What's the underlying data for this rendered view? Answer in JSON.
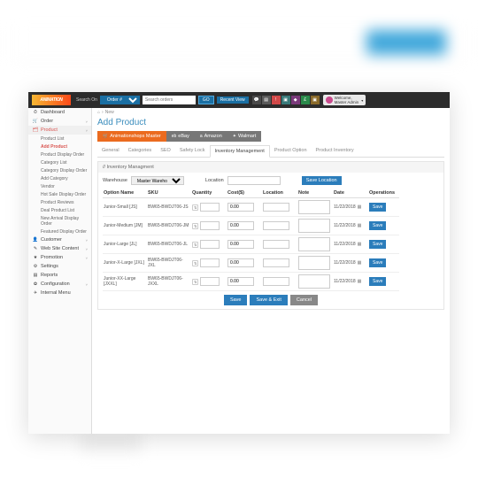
{
  "topbar": {
    "logo": "ANIMATION",
    "search_label": "Search On",
    "search_select": "Order #",
    "search_placeholder": "Search orders",
    "go": "GO",
    "recent": "Recent View",
    "user_name": "Welcome,",
    "user_role": "Master Admin"
  },
  "sidebar": {
    "items": [
      {
        "icon": "⏱",
        "label": "Dashboard",
        "chev": ""
      },
      {
        "icon": "🛒",
        "label": "Order",
        "chev": "˅"
      },
      {
        "icon": "🗂",
        "label": "Product",
        "chev": "˅",
        "active": true
      },
      {
        "icon": "👤",
        "label": "Customer",
        "chev": "˅"
      },
      {
        "icon": "✎",
        "label": "Web Site Content",
        "chev": "˅"
      },
      {
        "icon": "★",
        "label": "Promotion",
        "chev": "˅"
      },
      {
        "icon": "⚙",
        "label": "Settings",
        "chev": ""
      },
      {
        "icon": "▤",
        "label": "Reports",
        "chev": ""
      },
      {
        "icon": "✿",
        "label": "Configuration",
        "chev": "˅"
      },
      {
        "icon": "✈",
        "label": "Internal Menu",
        "chev": ""
      }
    ],
    "subs": [
      "Product List",
      "Add Product",
      "Product Display Order",
      "Category List",
      "Category Display Order",
      "Add Category",
      "Vendor",
      "Hot Sale Display Order",
      "Product Reviews",
      "Deal Product List",
      "New Arrival Display Order",
      "Featured Display Order"
    ]
  },
  "crumb": {
    "home": "⌂",
    "separator": "›",
    "current": "New"
  },
  "title": "Add Product",
  "store_tabs": [
    {
      "icon": "🛒",
      "label": "Animationshops Master",
      "active": true
    },
    {
      "icon": "eb",
      "label": "eBay"
    },
    {
      "icon": "a",
      "label": "Amazon"
    },
    {
      "icon": "✦",
      "label": "Walmart"
    }
  ],
  "form_tabs": [
    "General",
    "Categories",
    "SEO",
    "Safety Lock",
    "Inventory Management",
    "Product Option",
    "Product Inventory"
  ],
  "form_tab_active": 4,
  "section_title": "Inventory Managment",
  "warehouse": {
    "label": "Warehouse",
    "value": "Master Wareho"
  },
  "location": {
    "label": "Location",
    "value": "",
    "button": "Save Location"
  },
  "table": {
    "headers": [
      "Option Name",
      "SKU",
      "Quantity",
      "Cost($)",
      "Location",
      "Note",
      "Date",
      "Operations"
    ],
    "rows": [
      {
        "name": "Junior-Small [JS]",
        "sku": "BW65-BWDJT06-JS",
        "qty": "",
        "cost": "0.00",
        "loc": "",
        "note": "",
        "date": "11/22/2018",
        "op": "Save"
      },
      {
        "name": "Junior-Medium [JM]",
        "sku": "BW65-BWDJT06-JM",
        "qty": "",
        "cost": "0.00",
        "loc": "",
        "note": "",
        "date": "11/22/2018",
        "op": "Save"
      },
      {
        "name": "Junior-Large [JL]",
        "sku": "BW65-BWDJT06-JL",
        "qty": "",
        "cost": "0.00",
        "loc": "",
        "note": "",
        "date": "11/22/2018",
        "op": "Save"
      },
      {
        "name": "Junior-X-Large [JXL]",
        "sku": "BW65-BWDJT06-JXL",
        "qty": "",
        "cost": "0.00",
        "loc": "",
        "note": "",
        "date": "11/22/2018",
        "op": "Save"
      },
      {
        "name": "Junior-XX-Large [JXXL]",
        "sku": "BW65-BWDJT06-JXXL",
        "qty": "",
        "cost": "0.00",
        "loc": "",
        "note": "",
        "date": "11/22/2018",
        "op": "Save"
      }
    ]
  },
  "footer": {
    "save": "Save",
    "save_exit": "Save & Exit",
    "cancel": "Cancel"
  }
}
